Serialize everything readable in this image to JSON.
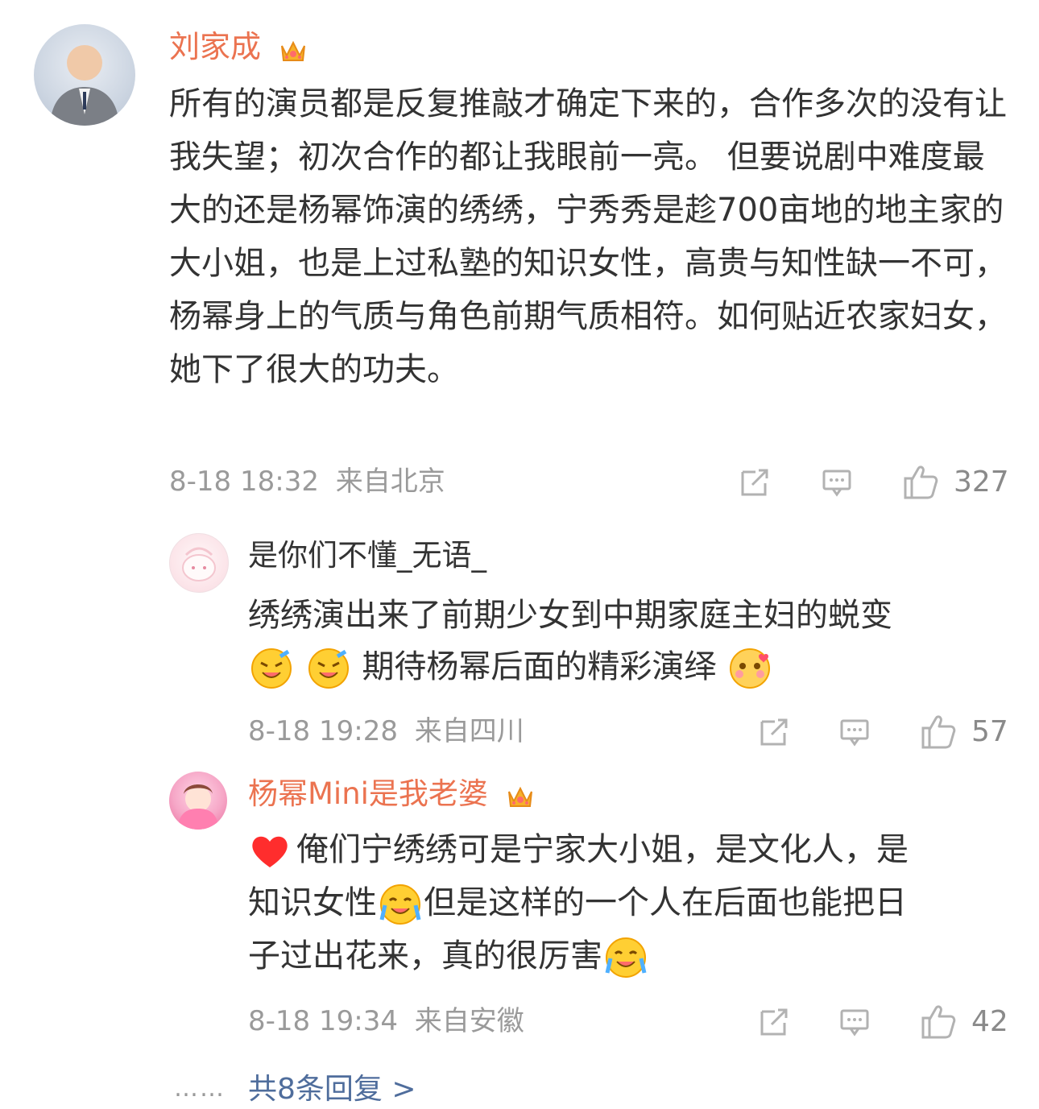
{
  "comment": {
    "user": "刘家成",
    "text": "所有的演员都是反复推敲才确定下来的，合作多次的没有让我失望；初次合作的都让我眼前一亮。 但要说剧中难度最大的还是杨幂饰演的绣绣，宁秀秀是趁700亩地的地主家的大小姐，也是上过私塾的知识女性，高贵与知性缺一不可，杨幂身上的气质与角色前期气质相符。如何贴近农家妇女，她下了很大的功夫。",
    "time": "8-18 18:32",
    "location": "来自北京",
    "likes": "327"
  },
  "replies": [
    {
      "user": "是你们不懂_无语_",
      "text1": "绣绣演出来了前期少女到中期家庭主妇的蜕变",
      "text2": "期待杨幂后面的精彩演绎",
      "time": "8-18 19:28",
      "location": "来自四川",
      "likes": "57"
    },
    {
      "user": "杨幂Mini是我老婆",
      "text1": "俺们宁绣绣可是宁家大小姐，是文化人，是",
      "text2": "知识女性",
      "text3": "但是这样的一个人在后面也能把日",
      "text4": "子过出花来，真的很厉害",
      "time": "8-18 19:34",
      "location": "来自安徽",
      "likes": "42"
    }
  ],
  "more": {
    "dots": "……",
    "label": "共8条回复 >"
  },
  "colors": {
    "name_highlight": "#eb7350",
    "meta": "#9a9a9a",
    "link": "#4f6d9c"
  }
}
